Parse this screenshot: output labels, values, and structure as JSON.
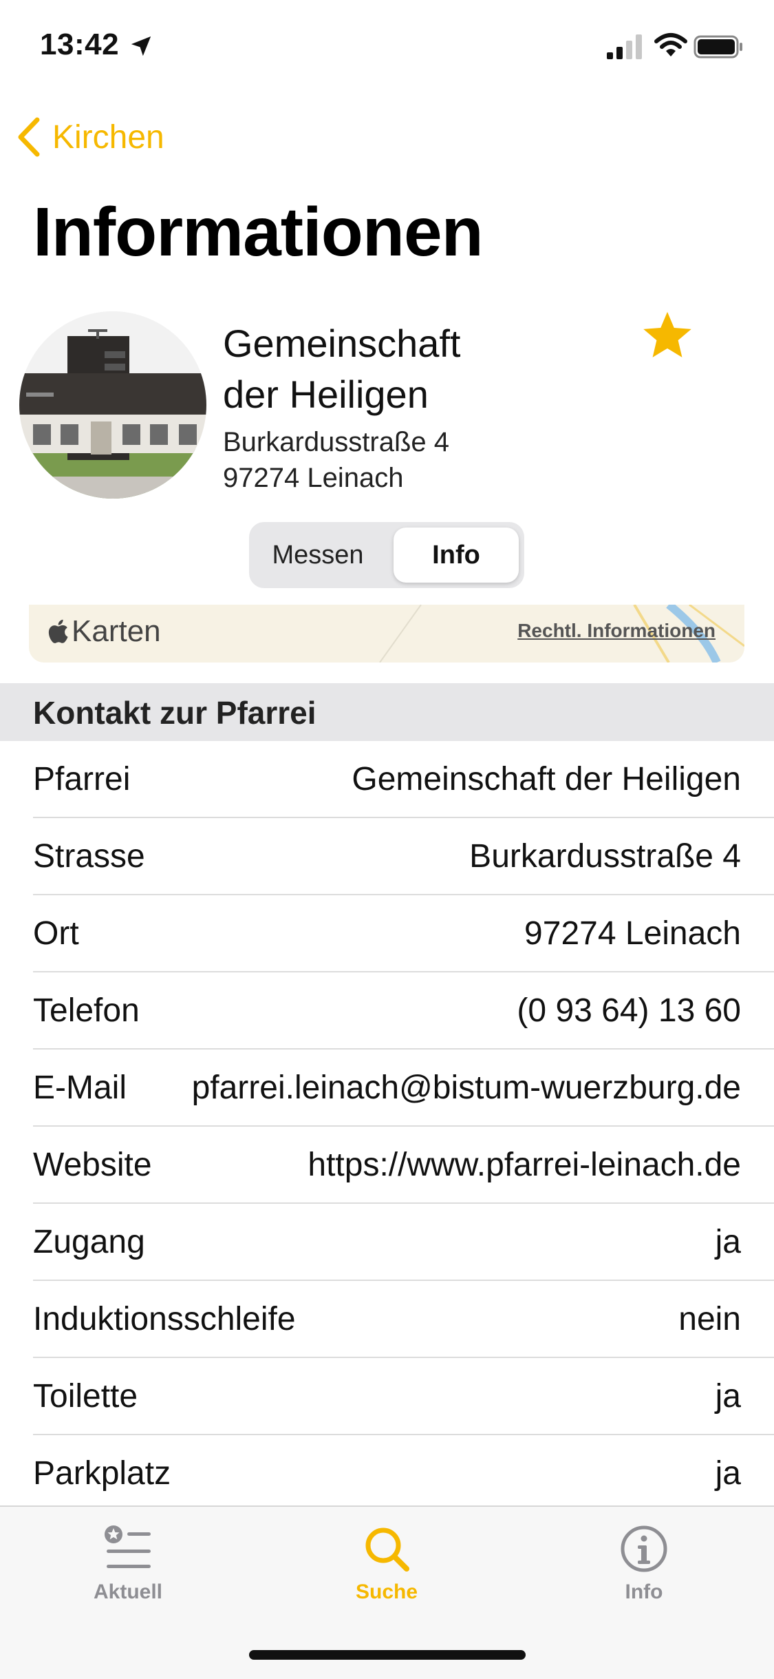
{
  "status": {
    "time": "13:42"
  },
  "nav": {
    "back_label": "Kirchen",
    "title": "Informationen"
  },
  "church": {
    "name": "Gemeinschaft der Heiligen",
    "street": "Burkardusstraße 4",
    "city": "97274 Leinach",
    "favorite": true
  },
  "segment": {
    "options": [
      "Messen",
      "Info"
    ],
    "selected": "Info"
  },
  "map": {
    "logo": "Karten",
    "legal": "Rechtl. Informationen"
  },
  "contact": {
    "header": "Kontakt zur Pfarrei",
    "rows": [
      {
        "label": "Pfarrei",
        "value": "Gemeinschaft der Heiligen"
      },
      {
        "label": "Strasse",
        "value": "Burkardusstraße 4"
      },
      {
        "label": "Ort",
        "value": "97274 Leinach"
      },
      {
        "label": "Telefon",
        "value": "(0 93 64) 13 60"
      },
      {
        "label": "E-Mail",
        "value": "pfarrei.leinach@bistum-wuerzburg.de"
      },
      {
        "label": "Website",
        "value": "https://www.pfarrei-leinach.de"
      },
      {
        "label": "Zugang",
        "value": "ja"
      },
      {
        "label": "Induktionsschleife",
        "value": "nein"
      },
      {
        "label": "Toilette",
        "value": "ja"
      },
      {
        "label": "Parkplatz",
        "value": "ja"
      }
    ]
  },
  "tabs": [
    {
      "label": "Aktuell",
      "icon": "star-list-icon"
    },
    {
      "label": "Suche",
      "icon": "search-icon",
      "active": true
    },
    {
      "label": "Info",
      "icon": "info-icon"
    }
  ],
  "colors": {
    "accent": "#f6b800",
    "inactive": "#8e8e93"
  }
}
